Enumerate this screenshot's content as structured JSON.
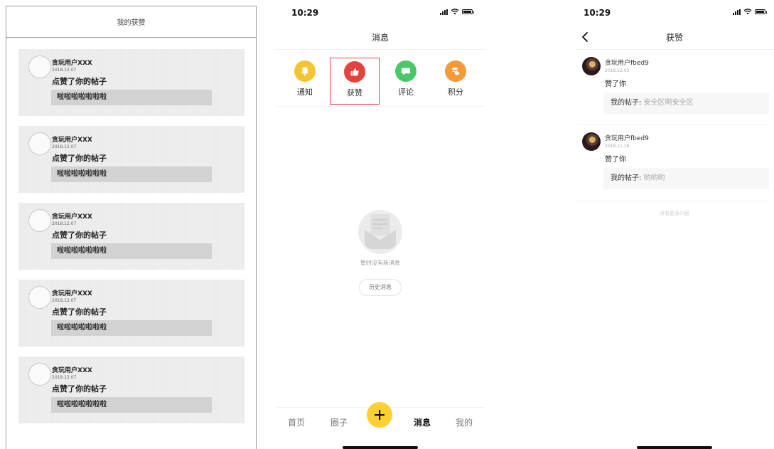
{
  "wireframe": {
    "header_title": "我的获赞",
    "cards": [
      {
        "name": "贪玩用户XXX",
        "date": "2018.12.07",
        "action": "点赞了你的帖子",
        "post": "啦啦啦啦啦啦啦"
      },
      {
        "name": "贪玩用户XXX",
        "date": "2018.12.07",
        "action": "点赞了你的帖子",
        "post": "啦啦啦啦啦啦啦"
      },
      {
        "name": "贪玩用户XXX",
        "date": "2018.12.07",
        "action": "点赞了你的帖子",
        "post": "啦啦啦啦啦啦啦"
      },
      {
        "name": "贪玩用户XXX",
        "date": "2018.12.07",
        "action": "点赞了你的帖子",
        "post": "啦啦啦啦啦啦啦"
      },
      {
        "name": "贪玩用户XXX",
        "date": "2018.12.07",
        "action": "点赞了你的帖子",
        "post": "啦啦啦啦啦啦啦"
      }
    ]
  },
  "messages": {
    "status_time": "10:29",
    "title": "消息",
    "categories": [
      {
        "label": "通知",
        "icon": "bell-icon",
        "color": "#f5c531"
      },
      {
        "label": "获赞",
        "icon": "thumbs-up-icon",
        "color": "#e5423e",
        "selected": true
      },
      {
        "label": "评论",
        "icon": "comment-icon",
        "color": "#4cc768"
      },
      {
        "label": "积分",
        "icon": "coins-icon",
        "color": "#f39a3a"
      }
    ],
    "empty_text": "暂时没有新消息",
    "history_button": "历史消息",
    "tabbar": {
      "home": "首页",
      "circle": "圈子",
      "messages": "消息",
      "mine": "我的",
      "fab_icon": "plus-icon",
      "fab_color": "#ffcf33"
    }
  },
  "likes": {
    "status_time": "10:29",
    "title": "获赞",
    "items": [
      {
        "name": "贪玩用户fbed9",
        "date": "2018.12.03",
        "action": "赞了你",
        "post_label": "我的帖子:",
        "post_text": "安全区啊安全区"
      },
      {
        "name": "贪玩用户fbed9",
        "date": "2018.11.16",
        "action": "赞了你",
        "post_label": "我的帖子:",
        "post_text": "哟哟哟"
      }
    ],
    "footer": "没有更多内容"
  }
}
